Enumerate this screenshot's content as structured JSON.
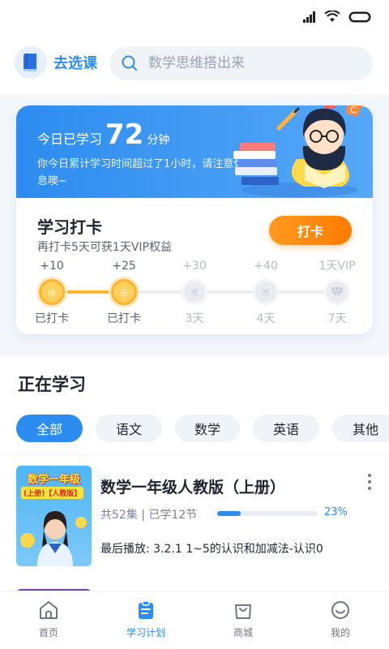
{
  "header": {
    "course_label": "去选课",
    "search_placeholder": "数学思维搭出来"
  },
  "study": {
    "today_prefix": "今日已学习",
    "minutes": "72",
    "minutes_unit": "分钟",
    "tip": "你今日累计学习时间超过了1小时，请注意休息噢~",
    "checkin_title": "学习打卡",
    "checkin_subtitle": "再打卡5天可获1天VIP权益",
    "checkin_button": "打卡",
    "days": [
      {
        "points": "+10",
        "label": "已打卡",
        "done": true
      },
      {
        "points": "+25",
        "label": "已打卡",
        "done": true
      },
      {
        "points": "+30",
        "label": "3天",
        "done": false
      },
      {
        "points": "+40",
        "label": "4天",
        "done": false
      },
      {
        "points": "1天VIP",
        "label": "7天",
        "done": false
      }
    ]
  },
  "learning": {
    "title": "正在学习",
    "filters": [
      "全部",
      "语文",
      "数学",
      "英语",
      "其他"
    ],
    "active_filter": "全部",
    "courses": [
      {
        "title": "数学一年级人教版（上册）",
        "meta": "共52集 | 已学12节",
        "progress": 0.23,
        "progress_label": "23%",
        "last_played": "最后播放: 3.2.1 1~5的认识和加减法-认识0",
        "thumb_title": "数学一年级",
        "thumb_tag": "(上册)【人教版】"
      }
    ]
  },
  "tabs": [
    {
      "label": "首页",
      "icon": "home-icon"
    },
    {
      "label": "学习计划",
      "icon": "study-plan-icon",
      "active": true
    },
    {
      "label": "商城",
      "icon": "shopping-bag-icon"
    },
    {
      "label": "我的",
      "icon": "smile-icon"
    }
  ],
  "colors": {
    "accent": "#2d8cf0",
    "orange": "#ff8a00",
    "coin": "#ffc23d"
  }
}
